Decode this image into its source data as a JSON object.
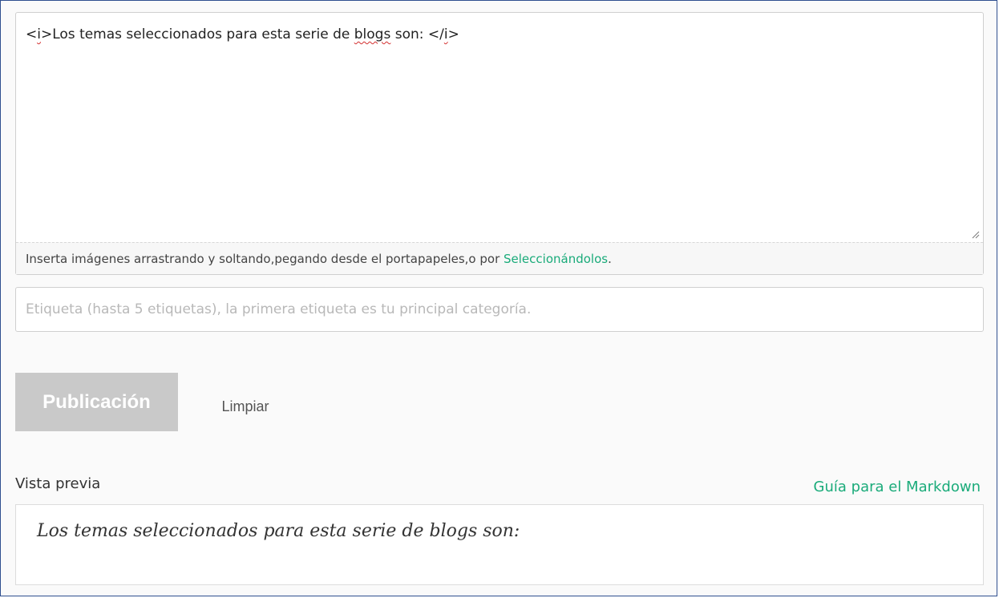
{
  "editor": {
    "content_prefix": "<",
    "content_tag_open": "i",
    "content_middle": ">Los temas seleccionados para esta serie de ",
    "content_blogs": "blogs",
    "content_after": " son: </",
    "content_tag_close": "i",
    "content_end": ">",
    "footer_text": "Inserta imágenes arrastrando y soltando,pegando desde el portapapeles,o por ",
    "footer_link": "Seleccionándolos",
    "footer_end": "."
  },
  "tags": {
    "placeholder": "Etiqueta (hasta 5 etiquetas), la primera etiqueta es tu principal categoría.",
    "value": ""
  },
  "actions": {
    "publish_label": "Publicación",
    "clear_label": "Limpiar"
  },
  "preview": {
    "label": "Vista previa",
    "markdown_guide": "Guía para el Markdown",
    "rendered_text": "Los temas seleccionados para esta serie de blogs son:"
  },
  "colors": {
    "accent": "#1aab7a",
    "frame_border": "#2f4f8f",
    "button_disabled": "#c9c9c9"
  }
}
